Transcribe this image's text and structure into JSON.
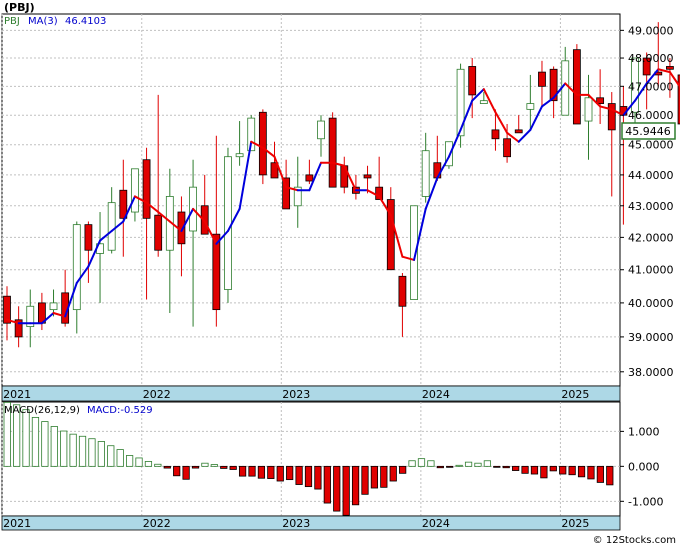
{
  "title": "(PBJ)",
  "legend": {
    "symbol": "PBJ",
    "ma_label": "MA(3)",
    "ma_value": "46.4103"
  },
  "last_price_label": "45.9446",
  "macd_legend": {
    "label": "MACD(26,12,9)",
    "value_label": "MACD:-0.529"
  },
  "footer": "© 12Stocks.com",
  "colors": {
    "up": "#2e7d2e",
    "down": "#e00000",
    "ma_up": "#0000dd",
    "ma_down": "#ee0000",
    "axis_band": "#add8e6",
    "grid": "#c0c0c0"
  },
  "chart_data": [
    {
      "type": "candlestick",
      "x_unit": "month index from first candle (2021-01 = 0)",
      "x_tick_labels": [
        "2021",
        "2022",
        "2023",
        "2024",
        "2025"
      ],
      "x_ticks_at": [
        0,
        12,
        24,
        36,
        48
      ],
      "y_tick_labels": [
        "38.0000",
        "39.0000",
        "40.0000",
        "41.0000",
        "42.0000",
        "43.0000",
        "44.0000",
        "45.0000",
        "46.0000",
        "47.0000",
        "48.0000",
        "49.0000"
      ],
      "ylim": [
        37.6,
        49.6
      ],
      "log_scale": true,
      "grid": true,
      "candles": [
        [
          40.2,
          40.5,
          38.9,
          39.4
        ],
        [
          39.5,
          39.9,
          38.7,
          39.0
        ],
        [
          39.3,
          40.4,
          38.7,
          39.9
        ],
        [
          40.0,
          40.3,
          39.2,
          39.4
        ],
        [
          39.8,
          40.4,
          39.6,
          40.0
        ],
        [
          40.3,
          41.0,
          39.3,
          39.4
        ],
        [
          39.8,
          42.5,
          39.1,
          42.4
        ],
        [
          42.4,
          42.5,
          40.6,
          41.6
        ],
        [
          41.5,
          42.8,
          40.0,
          41.8
        ],
        [
          41.6,
          43.6,
          41.5,
          43.1
        ],
        [
          43.5,
          44.5,
          41.4,
          42.6
        ],
        [
          42.8,
          44.2,
          42.5,
          44.2
        ],
        [
          44.5,
          44.9,
          40.1,
          42.6
        ],
        [
          42.7,
          46.7,
          41.4,
          41.6
        ],
        [
          41.6,
          44.2,
          39.7,
          43.3
        ],
        [
          42.8,
          43.3,
          40.8,
          41.8
        ],
        [
          42.2,
          44.5,
          39.3,
          43.6
        ],
        [
          43.0,
          44.0,
          42.2,
          42.1
        ],
        [
          42.1,
          45.3,
          39.3,
          39.8
        ],
        [
          40.4,
          44.9,
          40.0,
          44.6
        ],
        [
          44.6,
          45.8,
          44.3,
          44.7
        ],
        [
          44.8,
          46.0,
          44.8,
          45.9
        ],
        [
          46.1,
          46.2,
          43.7,
          44.0
        ],
        [
          44.4,
          45.1,
          43.9,
          43.9
        ],
        [
          43.9,
          44.5,
          42.9,
          42.9
        ],
        [
          43.0,
          44.6,
          42.3,
          43.6
        ],
        [
          44.0,
          44.5,
          43.7,
          43.8
        ],
        [
          45.2,
          46.0,
          44.6,
          45.8
        ],
        [
          45.9,
          46.1,
          44.3,
          43.6
        ],
        [
          44.3,
          44.6,
          43.4,
          43.6
        ],
        [
          43.6,
          44.0,
          43.2,
          43.4
        ],
        [
          44.0,
          44.3,
          43.4,
          43.9
        ],
        [
          43.6,
          44.6,
          43.4,
          43.2
        ],
        [
          43.2,
          43.6,
          41.1,
          41.0
        ],
        [
          40.8,
          40.9,
          39.0,
          39.9
        ],
        [
          40.1,
          43.0,
          40.1,
          43.0
        ],
        [
          43.3,
          45.4,
          43.1,
          44.8
        ],
        [
          44.4,
          45.3,
          43.8,
          43.9
        ],
        [
          44.3,
          45.1,
          44.2,
          45.1
        ],
        [
          45.3,
          47.8,
          44.9,
          47.6
        ],
        [
          47.7,
          48.0,
          45.9,
          46.7
        ],
        [
          46.4,
          46.8,
          46.4,
          46.5
        ],
        [
          45.5,
          46.2,
          44.8,
          45.2
        ],
        [
          45.2,
          45.7,
          44.4,
          44.6
        ],
        [
          45.5,
          46.0,
          45.4,
          45.4
        ],
        [
          46.2,
          47.4,
          45.5,
          46.4
        ],
        [
          47.5,
          47.9,
          46.3,
          47.0
        ],
        [
          47.6,
          47.7,
          45.9,
          46.5
        ],
        [
          46.0,
          48.4,
          46.0,
          47.9
        ],
        [
          48.3,
          48.5,
          45.8,
          45.7
        ],
        [
          45.8,
          47.4,
          44.5,
          46.6
        ],
        [
          46.6,
          47.6,
          45.7,
          46.4
        ],
        [
          46.4,
          46.8,
          43.3,
          45.5
        ],
        [
          46.3,
          47.0,
          42.4,
          46.0
        ],
        [
          46.1,
          48.0,
          45.6,
          48.0
        ],
        [
          48.0,
          48.2,
          46.2,
          47.4
        ],
        [
          47.5,
          49.3,
          47.0,
          47.4
        ],
        [
          47.7,
          48.0,
          46.6,
          47.6
        ],
        [
          47.4,
          47.4,
          45.8,
          45.7
        ],
        [
          45.6,
          46.3,
          45.1,
          45.9
        ]
      ],
      "ma3": [
        39.5,
        39.4,
        39.4,
        39.4,
        39.7,
        39.6,
        40.6,
        41.1,
        41.9,
        42.2,
        42.5,
        43.3,
        43.1,
        42.8,
        42.5,
        42.2,
        42.9,
        42.5,
        41.8,
        42.2,
        42.9,
        45.1,
        44.9,
        44.6,
        43.6,
        43.5,
        43.5,
        44.4,
        44.4,
        44.3,
        43.5,
        43.5,
        43.3,
        42.7,
        41.4,
        41.3,
        42.9,
        43.9,
        44.6,
        45.5,
        46.5,
        46.9,
        46.1,
        45.4,
        45.1,
        45.5,
        46.3,
        46.6,
        47.1,
        46.7,
        46.7,
        46.3,
        46.2,
        46.0,
        46.5,
        47.1,
        47.6,
        47.5,
        46.9,
        46.4
      ],
      "ma3_trend": [
        "u",
        "d",
        "u",
        "u",
        "u",
        "d",
        "u",
        "u",
        "u",
        "u",
        "u",
        "u",
        "d",
        "d",
        "d",
        "d",
        "u",
        "d",
        "d",
        "u",
        "u",
        "u",
        "d",
        "d",
        "d",
        "d",
        "u",
        "u",
        "d",
        "d",
        "d",
        "u",
        "d",
        "d",
        "d",
        "d",
        "u",
        "u",
        "u",
        "u",
        "u",
        "u",
        "d",
        "d",
        "d",
        "u",
        "u",
        "u",
        "u",
        "d",
        "d",
        "d",
        "d",
        "d",
        "u",
        "u",
        "u",
        "d",
        "d",
        "d"
      ],
      "visible_ma_label": "MA(3)"
    },
    {
      "type": "bar",
      "name": "MACD",
      "x_unit": "month index from first candle (2021-01 = 0)",
      "x_tick_labels": [
        "2021",
        "2022",
        "2023",
        "2024",
        "2025"
      ],
      "x_ticks_at": [
        0,
        12,
        24,
        36,
        48
      ],
      "y_tick_labels": [
        "1.000",
        "0.000",
        "-1.000"
      ],
      "ylim": [
        -1.42,
        1.84
      ],
      "values": [
        1.83,
        1.76,
        1.62,
        1.4,
        1.28,
        1.14,
        1.01,
        0.92,
        0.86,
        0.79,
        0.71,
        0.59,
        0.48,
        0.31,
        0.24,
        0.14,
        0.06,
        -0.05,
        -0.27,
        -0.37,
        -0.05,
        0.09,
        0.05,
        -0.06,
        -0.09,
        -0.28,
        -0.28,
        -0.34,
        -0.35,
        -0.42,
        -0.38,
        -0.52,
        -0.58,
        -0.65,
        -1.05,
        -1.28,
        -1.4,
        -1.1,
        -0.8,
        -0.62,
        -0.6,
        -0.42,
        -0.2,
        0.16,
        0.22,
        0.16,
        -0.04,
        -0.02,
        0.03,
        0.12,
        0.09,
        0.16,
        -0.02,
        -0.04,
        -0.12,
        -0.2,
        -0.22,
        -0.33,
        -0.13,
        -0.22,
        -0.24,
        -0.3,
        -0.36,
        -0.46,
        -0.53
      ],
      "value_colors": "green outline when >= 0, red fill when < 0"
    }
  ]
}
